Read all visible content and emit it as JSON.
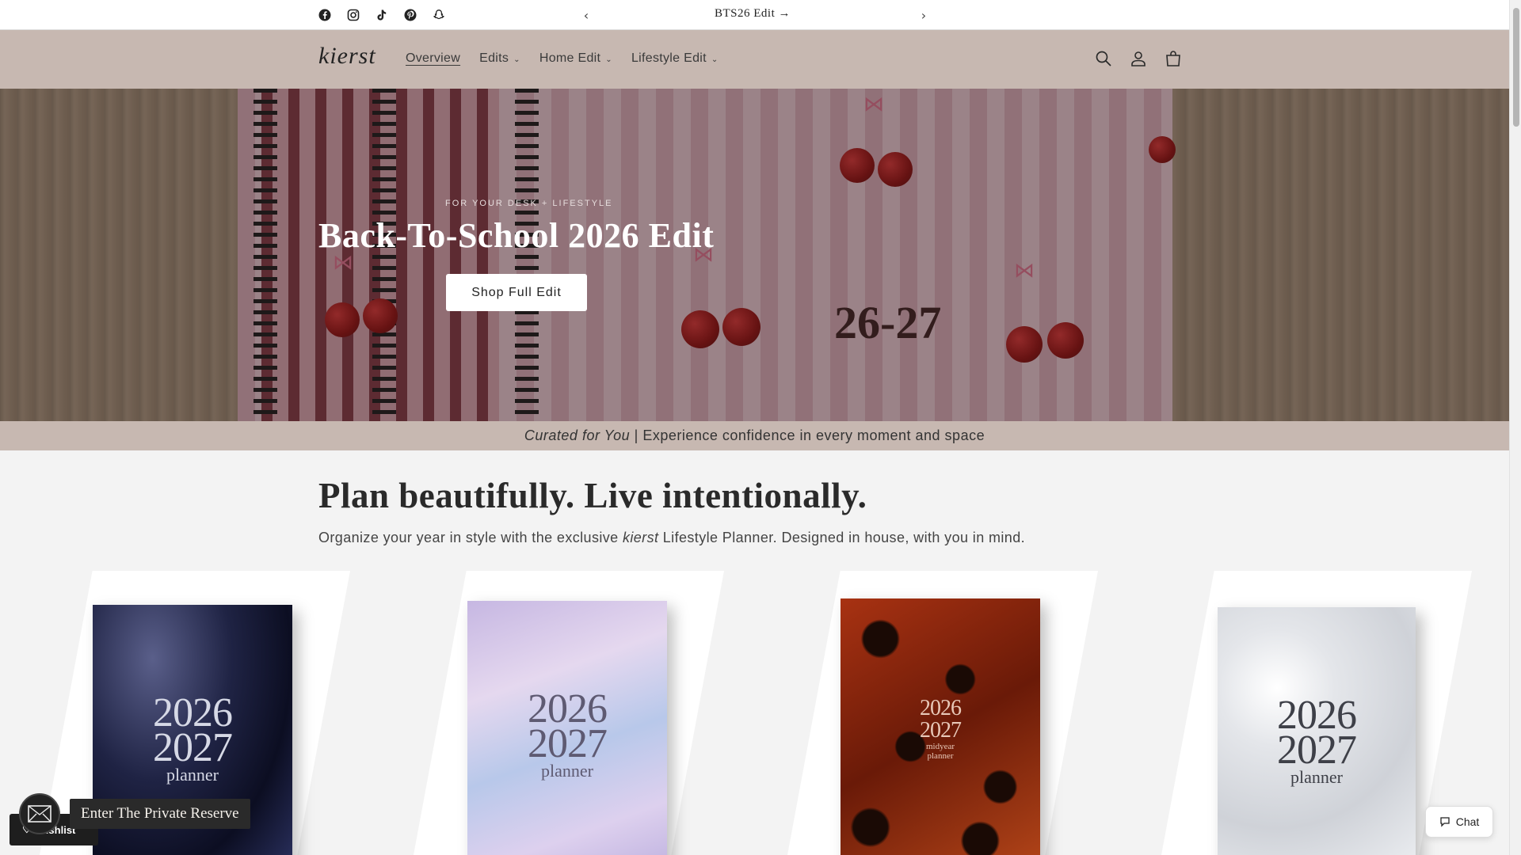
{
  "announcement": {
    "text": "BTS26 Edit",
    "arrow": "→",
    "prev_icon": "chevron-left-icon",
    "next_icon": "chevron-right-icon"
  },
  "social": [
    "facebook-icon",
    "instagram-icon",
    "tiktok-icon",
    "pinterest-icon",
    "snapchat-icon"
  ],
  "header": {
    "logo_text": "kierst",
    "nav": [
      {
        "label": "Overview",
        "active": true
      },
      {
        "label": "Edits",
        "dropdown": true
      },
      {
        "label": "Home Edit",
        "dropdown": true
      },
      {
        "label": "Lifestyle Edit",
        "dropdown": true
      }
    ],
    "icons": [
      "search-icon",
      "account-icon",
      "cart-icon"
    ]
  },
  "hero": {
    "kicker": "FOR YOUR DESK + LIFESTYLE",
    "title": "Back-To-School 2026 Edit",
    "cta": "Shop Full Edit",
    "notebook_label": "26-27"
  },
  "tagline": {
    "italic": "Curated for You",
    "rest": " | Experience confidence in every moment and space"
  },
  "intro": {
    "title": "Plan beautifully. Live intentionally.",
    "sub_before": "Organize your year in style with the exclusive ",
    "sub_brand": "kierst",
    "sub_after": " Lifestyle Planner. Designed in house, with you in mind."
  },
  "products": [
    {
      "year1": "2026",
      "year2": "2027",
      "label": "planner"
    },
    {
      "year1": "2026",
      "year2": "2027",
      "label": "planner"
    },
    {
      "year1": "2026",
      "year2": "2027",
      "sub": "midyear",
      "label": "planner"
    },
    {
      "year1": "2026",
      "year2": "2027",
      "label": "planner"
    }
  ],
  "widgets": {
    "private_reserve": "Enter The Private Reserve",
    "wishlist": "Wishlist",
    "chat": "Chat"
  },
  "colors": {
    "header_bg": "#c7b8b1",
    "page_bg": "#f3f3f3"
  }
}
